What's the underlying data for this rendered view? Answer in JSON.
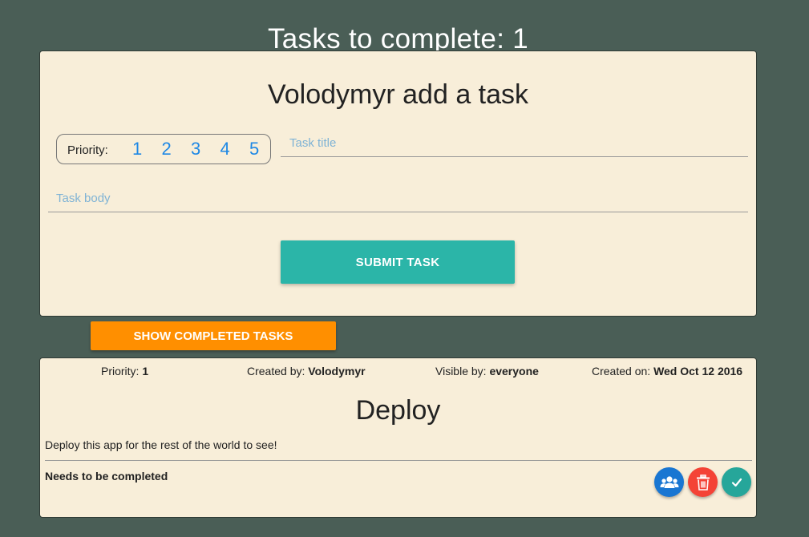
{
  "header": {
    "title": "Tasks to complete: 1"
  },
  "form": {
    "heading": "Volodymyr add a task",
    "priority_label": "Priority:",
    "priority_options": [
      "1",
      "2",
      "3",
      "4",
      "5"
    ],
    "title_placeholder": "Task title",
    "title_value": "",
    "body_placeholder": "Task body",
    "body_value": "",
    "submit_label": "SUBMIT TASK"
  },
  "toggle_completed_label": "SHOW COMPLETED TASKS",
  "task": {
    "priority_label": "Priority:",
    "priority": "1",
    "created_by_label": "Created by:",
    "created_by": "Volodymyr",
    "visible_by_label": "Visible by:",
    "visible_by": "everyone",
    "created_on_label": "Created on:",
    "created_on": "Wed Oct 12 2016",
    "title": "Deploy",
    "body": "Deploy this app for the rest of the world to see!",
    "status": "Needs to be completed",
    "actions": [
      {
        "name": "share",
        "icon": "group-icon",
        "color": "#1976d2"
      },
      {
        "name": "delete",
        "icon": "trash-icon",
        "color": "#f44336"
      },
      {
        "name": "complete",
        "icon": "check-icon",
        "color": "#26a69a"
      }
    ]
  },
  "colors": {
    "background": "#4a5e56",
    "card": "#f8eed9",
    "accent_teal": "#2bb5a8",
    "accent_orange": "#ff8f00",
    "priority_blue": "#1e88e5"
  }
}
